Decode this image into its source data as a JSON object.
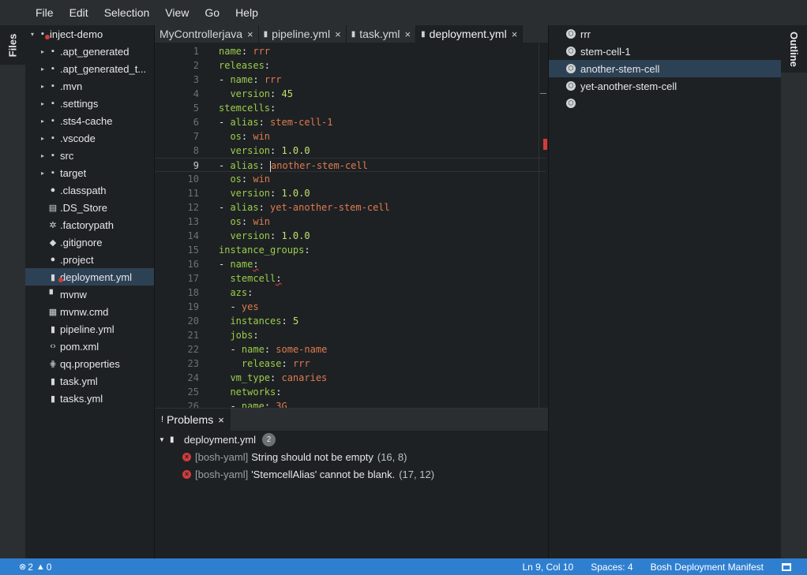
{
  "menubar": {
    "items": [
      "File",
      "Edit",
      "Selection",
      "View",
      "Go",
      "Help"
    ]
  },
  "left_panel": {
    "tab_label": "Files"
  },
  "right_panel": {
    "tab_label": "Outline"
  },
  "explorer": {
    "items": [
      {
        "label": "inject-demo",
        "twisty": "▾",
        "icon": "folder-icon",
        "glyph": "▪"
      },
      {
        "label": ".apt_generated",
        "twisty": "▸",
        "icon": "folder-icon",
        "glyph": "▪"
      },
      {
        "label": ".apt_generated_t...",
        "twisty": "▸",
        "icon": "folder-icon",
        "glyph": "▪"
      },
      {
        "label": ".mvn",
        "twisty": "▸",
        "icon": "folder-icon",
        "glyph": "▪"
      },
      {
        "label": ".settings",
        "twisty": "▸",
        "icon": "folder-icon",
        "glyph": "▪"
      },
      {
        "label": ".sts4-cache",
        "twisty": "▸",
        "icon": "folder-icon",
        "glyph": "▪"
      },
      {
        "label": ".vscode",
        "twisty": "▸",
        "icon": "folder-icon",
        "glyph": "▪"
      },
      {
        "label": "src",
        "twisty": "▸",
        "icon": "folder-icon",
        "glyph": "▪"
      },
      {
        "label": "target",
        "twisty": "▸",
        "icon": "folder-icon",
        "glyph": "▪"
      },
      {
        "label": ".classpath",
        "twisty": "",
        "icon": "circle-file-icon",
        "glyph": "●"
      },
      {
        "label": ".DS_Store",
        "twisty": "",
        "icon": "binary-file-icon",
        "glyph": "▤"
      },
      {
        "label": ".factorypath",
        "twisty": "",
        "icon": "gear-file-icon",
        "glyph": "✲"
      },
      {
        "label": ".gitignore",
        "twisty": "",
        "icon": "git-file-icon",
        "glyph": "◆"
      },
      {
        "label": ".project",
        "twisty": "",
        "icon": "circle-file-icon",
        "glyph": "●"
      },
      {
        "label": "deployment.yml",
        "twisty": "",
        "icon": "yaml-file-icon",
        "glyph": "▮"
      },
      {
        "label": "mvnw",
        "twisty": "",
        "icon": "file-icon",
        "glyph": "▘"
      },
      {
        "label": "mvnw.cmd",
        "twisty": "",
        "icon": "windows-file-icon",
        "glyph": "▦"
      },
      {
        "label": "pipeline.yml",
        "twisty": "",
        "icon": "yaml-file-icon",
        "glyph": "▮"
      },
      {
        "label": "pom.xml",
        "twisty": "",
        "icon": "code-file-icon",
        "glyph": "‹›"
      },
      {
        "label": "qq.properties",
        "twisty": "",
        "icon": "properties-file-icon",
        "glyph": "⋕"
      },
      {
        "label": "task.yml",
        "twisty": "",
        "icon": "yaml-file-icon",
        "glyph": "▮"
      },
      {
        "label": "tasks.yml",
        "twisty": "",
        "icon": "yaml-file-icon",
        "glyph": "▮"
      }
    ]
  },
  "tabs": [
    {
      "label": "MyControllerjava",
      "icon": "",
      "close": "×"
    },
    {
      "label": "pipeline.yml",
      "icon": "▮",
      "close": "×"
    },
    {
      "label": "task.yml",
      "icon": "▮",
      "close": "×"
    },
    {
      "label": "deployment.yml",
      "icon": "▮",
      "close": "×"
    }
  ],
  "editor": {
    "line_numbers": [
      "1",
      "2",
      "3",
      "4",
      "5",
      "6",
      "7",
      "8",
      "9",
      "10",
      "11",
      "12",
      "13",
      "14",
      "15",
      "16",
      "17",
      "18",
      "19",
      "20",
      "21",
      "22",
      "23",
      "24",
      "25",
      "26"
    ],
    "lines": [
      {
        "indent": "",
        "dash": "",
        "key": "name",
        "colon": ": ",
        "value": "rrr",
        "vtype": "v"
      },
      {
        "indent": "",
        "dash": "",
        "key": "releases",
        "colon": ":",
        "value": "",
        "vtype": "v"
      },
      {
        "indent": "",
        "dash": "- ",
        "key": "name",
        "colon": ": ",
        "value": "rrr",
        "vtype": "v"
      },
      {
        "indent": "  ",
        "dash": "",
        "key": "version",
        "colon": ": ",
        "value": "45",
        "vtype": "n"
      },
      {
        "indent": "",
        "dash": "",
        "key": "stemcells",
        "colon": ":",
        "value": "",
        "vtype": "v"
      },
      {
        "indent": "",
        "dash": "- ",
        "key": "alias",
        "colon": ": ",
        "value": "stem-cell-1",
        "vtype": "v"
      },
      {
        "indent": "  ",
        "dash": "",
        "key": "os",
        "colon": ": ",
        "value": "win",
        "vtype": "v"
      },
      {
        "indent": "  ",
        "dash": "",
        "key": "version",
        "colon": ": ",
        "value": "1.0.0",
        "vtype": "n"
      },
      {
        "indent": "",
        "dash": "- ",
        "key": "alias",
        "colon": ": ",
        "value": "another-stem-cell",
        "vtype": "v"
      },
      {
        "indent": "  ",
        "dash": "",
        "key": "os",
        "colon": ": ",
        "value": "win",
        "vtype": "v"
      },
      {
        "indent": "  ",
        "dash": "",
        "key": "version",
        "colon": ": ",
        "value": "1.0.0",
        "vtype": "n"
      },
      {
        "indent": "",
        "dash": "- ",
        "key": "alias",
        "colon": ": ",
        "value": "yet-another-stem-cell",
        "vtype": "v"
      },
      {
        "indent": "  ",
        "dash": "",
        "key": "os",
        "colon": ": ",
        "value": "win",
        "vtype": "v"
      },
      {
        "indent": "  ",
        "dash": "",
        "key": "version",
        "colon": ": ",
        "value": "1.0.0",
        "vtype": "n"
      },
      {
        "indent": "",
        "dash": "",
        "key": "instance_groups",
        "colon": ":",
        "value": "",
        "vtype": "v"
      },
      {
        "indent": "",
        "dash": "- ",
        "key": "name",
        "colon": ":",
        "value": "",
        "vtype": "v"
      },
      {
        "indent": "  ",
        "dash": "",
        "key": "stemcell",
        "colon": ":",
        "value": "",
        "vtype": "v"
      },
      {
        "indent": "  ",
        "dash": "",
        "key": "azs",
        "colon": ":",
        "value": "",
        "vtype": "v"
      },
      {
        "indent": "  ",
        "dash": "- ",
        "key": "",
        "colon": "",
        "value": "yes",
        "vtype": "v"
      },
      {
        "indent": "  ",
        "dash": "",
        "key": "instances",
        "colon": ": ",
        "value": "5",
        "vtype": "n"
      },
      {
        "indent": "  ",
        "dash": "",
        "key": "jobs",
        "colon": ":",
        "value": "",
        "vtype": "v"
      },
      {
        "indent": "  ",
        "dash": "- ",
        "key": "name",
        "colon": ": ",
        "value": "some-name",
        "vtype": "v"
      },
      {
        "indent": "    ",
        "dash": "",
        "key": "release",
        "colon": ": ",
        "value": "rrr",
        "vtype": "v"
      },
      {
        "indent": "  ",
        "dash": "",
        "key": "vm_type",
        "colon": ": ",
        "value": "canaries",
        "vtype": "v"
      },
      {
        "indent": "  ",
        "dash": "",
        "key": "networks",
        "colon": ":",
        "value": "",
        "vtype": "v"
      },
      {
        "indent": "  ",
        "dash": "- ",
        "key": "name",
        "colon": ": ",
        "value": "3G",
        "vtype": "v"
      }
    ],
    "current_line": 9
  },
  "problems": {
    "tab_label": "Problems",
    "tab_icon": "!",
    "close": "×",
    "file": "deployment.yml",
    "count": "2",
    "entries": [
      {
        "source": "[bosh-yaml]",
        "message": "String should not be empty",
        "location": "(16, 8)"
      },
      {
        "source": "[bosh-yaml]",
        "message": "'StemcellAlias' cannot be blank.",
        "location": "(17, 12)"
      }
    ]
  },
  "outline": {
    "items": [
      {
        "label": "rrr"
      },
      {
        "label": "stem-cell-1"
      },
      {
        "label": "another-stem-cell"
      },
      {
        "label": "yet-another-stem-cell"
      },
      {
        "label": ""
      }
    ],
    "selected_index": 2
  },
  "statusbar": {
    "errors": "2",
    "warnings": "0",
    "position": "Ln 9, Col 10",
    "spaces": "Spaces: 4",
    "language": "Bosh Deployment Manifest"
  },
  "colors": {
    "accent": "#2f7fd1",
    "key": "#9acd4a",
    "string": "#e07a4e",
    "number": "#bde36b",
    "error": "#d23b3b",
    "selection": "#2d4155"
  }
}
